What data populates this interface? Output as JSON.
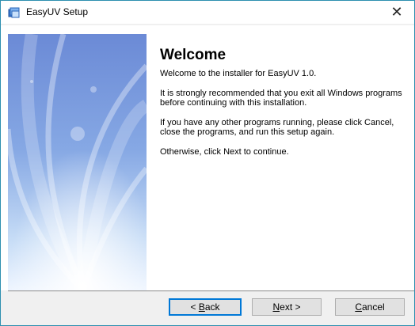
{
  "window": {
    "title": "EasyUV Setup",
    "close_glyph": "✕",
    "icon": "installer-icon"
  },
  "welcome": {
    "heading": "Welcome",
    "paragraphs": [
      "Welcome to the installer for EasyUV 1.0.",
      "It is strongly recommended that you exit all Windows programs before continuing with this installation.",
      "If you have any other programs running, please click Cancel, close the programs, and run this setup again.",
      "Otherwise, click Next to continue."
    ]
  },
  "buttons": {
    "back": {
      "prefix": "< ",
      "accel": "B",
      "rest": "ack"
    },
    "next": {
      "accel": "N",
      "rest": "ext >"
    },
    "cancel": {
      "accel": "C",
      "rest": "ancel"
    }
  },
  "colors": {
    "banner_top": "#6c8bd6",
    "banner_mid": "#9fc0ee",
    "banner_bottom": "#ffffff",
    "focus_border": "#0078d7",
    "window_border": "#2d8fb0"
  }
}
